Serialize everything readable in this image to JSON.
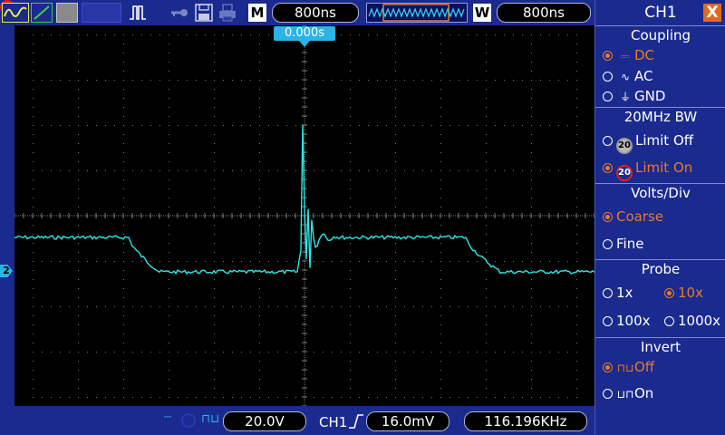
{
  "toolbar": {
    "icons": [
      "waveform-icon",
      "ramp-icon",
      "grey-block-icon",
      "empty-box-icon",
      "pulse-icon",
      "record-icon",
      "key-icon",
      "save-icon",
      "print-icon"
    ],
    "memory_label": "M",
    "memory_timebase": "800ns",
    "window_label": "W",
    "window_timebase": "800ns"
  },
  "display": {
    "trigger_position": "0.000s",
    "channel_marker": "2",
    "colors": {
      "trace": "#2ee6e6",
      "grid": "#7a7a7a",
      "background": "#000000"
    }
  },
  "menu": {
    "title": "CH1",
    "close": "X",
    "coupling": {
      "title": "Coupling",
      "options": [
        {
          "glyph": "DC",
          "label": "DC",
          "selected": true
        },
        {
          "glyph": "AC",
          "label": "AC",
          "selected": false
        },
        {
          "glyph": "GND",
          "label": "GND",
          "selected": false
        }
      ]
    },
    "bandwidth": {
      "title": "20MHz BW",
      "badge": "20",
      "options": [
        {
          "label": "Limit Off",
          "selected": false
        },
        {
          "label": "Limit On",
          "selected": true
        }
      ]
    },
    "volts_div": {
      "title": "Volts/Div",
      "options": [
        {
          "label": "Coarse",
          "selected": true
        },
        {
          "label": "Fine",
          "selected": false
        }
      ]
    },
    "probe": {
      "title": "Probe",
      "options": [
        {
          "label": "1x",
          "selected": false
        },
        {
          "label": "10x",
          "selected": true
        },
        {
          "label": "100x",
          "selected": false
        },
        {
          "label": "1000x",
          "selected": false
        }
      ]
    },
    "invert": {
      "title": "Invert",
      "options": [
        {
          "label": "Off",
          "selected": true
        },
        {
          "label": "On",
          "selected": false
        }
      ]
    }
  },
  "status": {
    "volts_div": "20.0V",
    "trigger_channel": "CH1",
    "trigger_level": "16.0mV",
    "frequency": "116.196KHz"
  }
}
